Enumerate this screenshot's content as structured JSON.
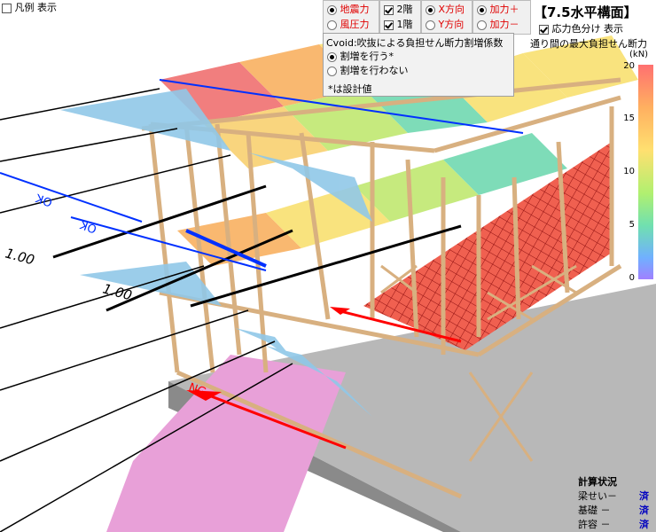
{
  "top_left": {
    "legend_label": "凡例 表示",
    "legend_checked": false
  },
  "load": {
    "seismic": "地震力",
    "wind": "風圧力",
    "selected": "seismic"
  },
  "floors": {
    "f2": "2階",
    "f1": "1階",
    "f2_checked": true,
    "f1_checked": true
  },
  "direction": {
    "x": "X方向",
    "y": "Y方向",
    "selected": "x"
  },
  "sign": {
    "plus": "加力＋",
    "minus": "加力－",
    "selected": "plus"
  },
  "view_title": "【7.5水平構面】",
  "stress_color": {
    "label": "応力色分け 表示",
    "checked": true
  },
  "legend": {
    "title": "通り間の最大負担せん断力",
    "unit": "(kN)",
    "ticks": [
      "20",
      "15",
      "10",
      "5",
      "0"
    ]
  },
  "popup": {
    "title": "Cvoid:吹抜による負担せん断力割増係数",
    "opt1": "割増を行う*",
    "opt2": "割増を行わない",
    "note": "*は設計値",
    "selected": "opt1"
  },
  "scene_labels": {
    "ratio1": "1.00",
    "ratio2": "1.00",
    "ok1": "OK",
    "ok2": "OK",
    "ng": "NG"
  },
  "status": {
    "title": "計算状況",
    "rows": [
      {
        "label": "梁せい－",
        "value": "済"
      },
      {
        "label": "基礎 －",
        "value": "済"
      },
      {
        "label": "許容 －",
        "value": "済"
      }
    ]
  },
  "colors": {
    "accent_red": "#e00000",
    "accent_blue": "#0000c0",
    "timber": "#e8c9a0"
  }
}
